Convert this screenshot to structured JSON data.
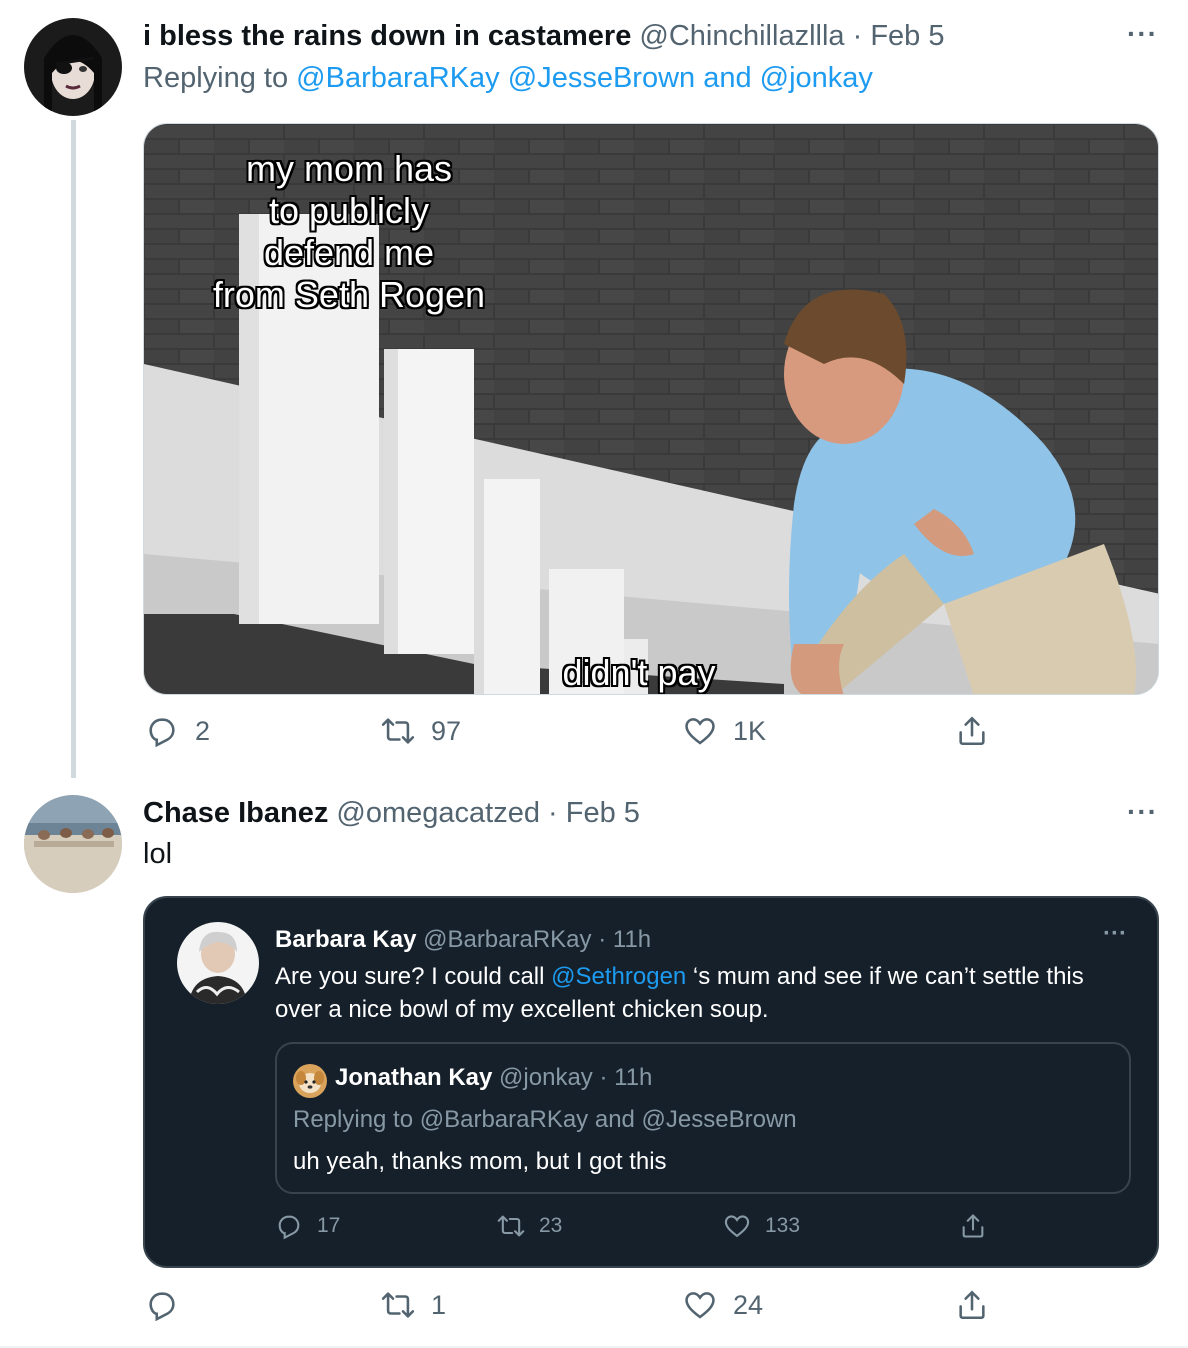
{
  "tweet1": {
    "name": "i bless the rains down in castamere",
    "handle": "@Chinchillazllla",
    "sep": "·",
    "date": "Feb 5",
    "more": "···",
    "replying_prefix": "Replying to ",
    "mentions": [
      "@BarbaraRKay",
      "@JesseBrown"
    ],
    "and": " and ",
    "mention_last": "@jonkay",
    "meme": {
      "caption_top": "my mom has\nto publicly\ndefend me\nfrom Seth Rogen",
      "caption_bottom": "didn't pay"
    },
    "actions": {
      "replies": "2",
      "retweets": "97",
      "likes": "1K"
    }
  },
  "tweet2": {
    "name": "Chase Ibanez",
    "handle": "@omegacatzed",
    "sep": "·",
    "date": "Feb 5",
    "more": "···",
    "text": "lol",
    "actions": {
      "replies": "",
      "retweets": "1",
      "likes": "24"
    }
  },
  "embedded": {
    "name": "Barbara Kay",
    "handle": "@BarbaraRKay",
    "sep": "·",
    "time": "11h",
    "more": "···",
    "text_before": "Are you sure? I could call ",
    "mention": "@Sethrogen",
    "text_after": " ‘s mum and see if we can’t settle this over a nice bowl of my excellent chicken soup.",
    "quote": {
      "name": "Jonathan Kay",
      "handle": "@jonkay",
      "sep": "·",
      "time": "11h",
      "replying": "Replying to @BarbaraRKay and @JesseBrown",
      "text": "uh yeah, thanks mom, but I got this"
    },
    "actions": {
      "replies": "17",
      "retweets": "23",
      "likes": "133"
    }
  },
  "colors": {
    "accent": "#1d9bf0",
    "muted": "#536471",
    "dark_bg": "#15202b"
  }
}
